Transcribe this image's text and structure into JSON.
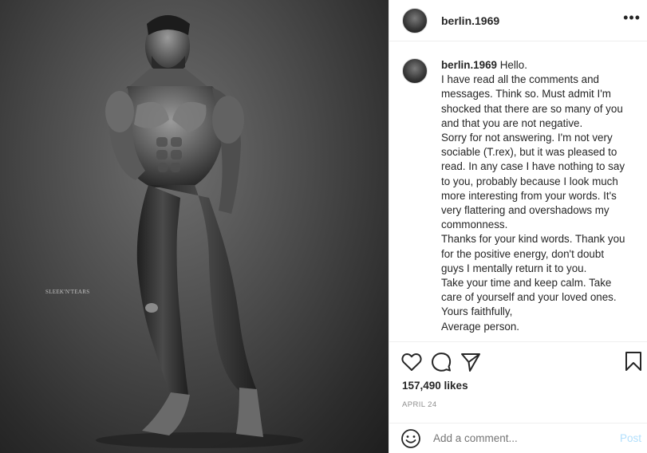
{
  "photo": {
    "watermark": "SLEEK'N'TEARS"
  },
  "post": {
    "author": "berlin.1969",
    "more_icon": "more-horizontal-icon",
    "caption_lines": [
      "Hello.",
      "I have read all the comments and",
      "messages. Think so. Must admit I'm",
      "shocked that there are so many of you",
      "and that you are not negative.",
      "Sorry for not answering. I'm not very",
      "sociable (T.rex), but it was pleased to",
      "read. In any case I have nothing to say",
      "to you, probably because I look much",
      "more interesting from your words. It's",
      "very flattering and overshadows my",
      "commonness.",
      "Thanks for your kind words. Thank you",
      "for the positive energy, don't doubt",
      "guys I mentally return it to you.",
      "Take your time and keep calm. Take",
      "care of yourself and your loved ones.",
      "Yours faithfully,",
      "Average person."
    ],
    "likes": "157,490 likes",
    "date": "APRIL 24"
  },
  "comment": {
    "placeholder": "Add a comment...",
    "post_label": "Post"
  },
  "colors": {
    "text": "#262626",
    "muted": "#8e8e8e",
    "post_disabled": "#b2dffc",
    "divider": "#efefef"
  }
}
